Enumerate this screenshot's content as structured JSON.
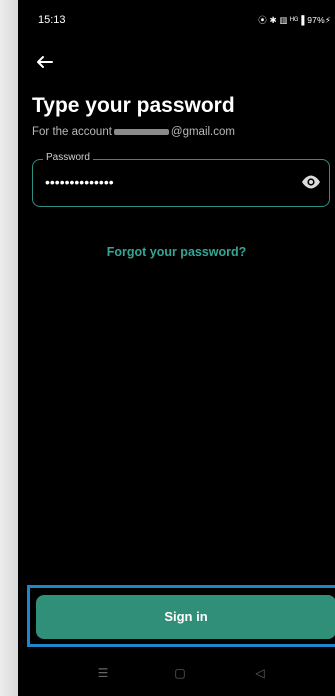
{
  "status": {
    "time": "15:13",
    "icons": "ⓘ ✱ ☰a ᴴᴳ ▌97%⚡"
  },
  "header": {
    "back_icon": "arrow-left-icon",
    "title": "Type your password"
  },
  "account": {
    "prefix": "For the account",
    "suffix": "@gmail.com"
  },
  "password": {
    "label": "Password",
    "value": "••••••••••••••",
    "eye_icon": "eye-icon"
  },
  "links": {
    "forgot": "Forgot your password?"
  },
  "actions": {
    "signin": "Sign in"
  },
  "nav": {
    "menu": "☰",
    "home": "▢",
    "back": "◁"
  },
  "colors": {
    "accent": "#2f8f78",
    "link": "#36a594",
    "highlight": "#1f86c9"
  }
}
